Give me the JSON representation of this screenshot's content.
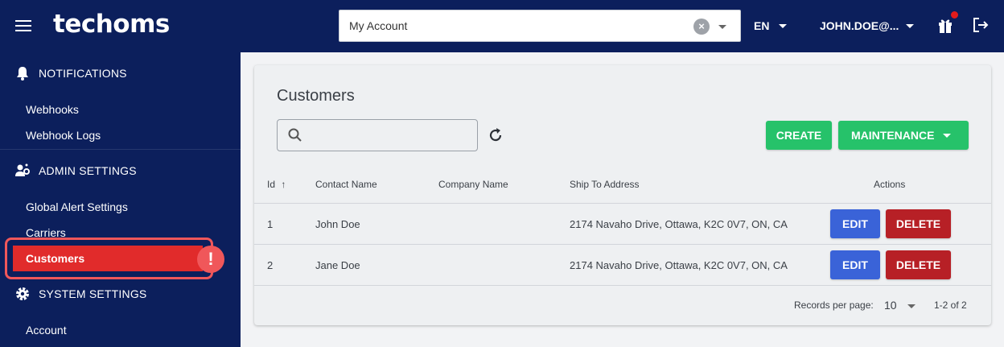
{
  "brand": {
    "logo_text": "techoms"
  },
  "header": {
    "account_select_value": "My Account",
    "language": "EN",
    "user": "JOHN.DOE@..."
  },
  "sidebar": {
    "notifications": {
      "label": "NOTIFICATIONS",
      "items": [
        "Webhooks",
        "Webhook Logs"
      ]
    },
    "admin_settings": {
      "label": "ADMIN SETTINGS",
      "items": [
        "Global Alert Settings",
        "Carriers",
        "Customers"
      ]
    },
    "system_settings": {
      "label": "SYSTEM SETTINGS",
      "items": [
        "Account"
      ]
    },
    "active_item": "Customers",
    "alert_badge": "!"
  },
  "main": {
    "title": "Customers",
    "search_placeholder": "",
    "create_label": "CREATE",
    "maintenance_label": "MAINTENANCE",
    "columns": [
      "Id",
      "Contact Name",
      "Company Name",
      "Ship To Address",
      "Actions"
    ],
    "rows": [
      {
        "id": "1",
        "contact": "John Doe",
        "company": "",
        "address": "2174 Navaho Drive, Ottawa, K2C 0V7, ON, CA"
      },
      {
        "id": "2",
        "contact": "Jane Doe",
        "company": "",
        "address": "2174 Navaho Drive, Ottawa, K2C 0V7, ON, CA"
      }
    ],
    "edit_label": "EDIT",
    "delete_label": "DELETE",
    "footer": {
      "records_per_page_label": "Records per page:",
      "records_per_page_value": "10",
      "range": "1-2 of 2"
    }
  },
  "colors": {
    "navy": "#0c1f5c",
    "green": "#26c26a",
    "blue": "#3a63d8",
    "red": "#b72026",
    "highlight": "#f0575a"
  }
}
